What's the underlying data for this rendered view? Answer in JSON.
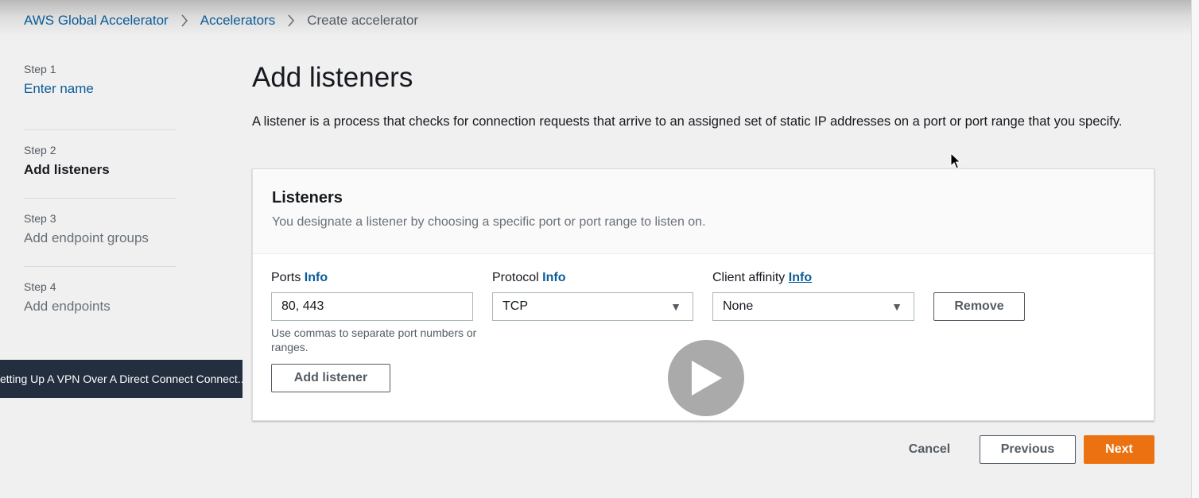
{
  "breadcrumb": {
    "items": [
      "AWS Global Accelerator",
      "Accelerators"
    ],
    "current": "Create accelerator"
  },
  "steps": [
    {
      "num": "Step 1",
      "label": "Enter name",
      "state": "link"
    },
    {
      "num": "Step 2",
      "label": "Add listeners",
      "state": "active"
    },
    {
      "num": "Step 3",
      "label": "Add endpoint groups",
      "state": "disabled"
    },
    {
      "num": "Step 4",
      "label": "Add endpoints",
      "state": "disabled"
    }
  ],
  "page": {
    "title": "Add listeners",
    "description": "A listener is a process that checks for connection requests that arrive to an assigned set of static IP addresses on a port or port range that you specify."
  },
  "listeners": {
    "title": "Listeners",
    "subtitle": "You designate a listener by choosing a specific port or port range to listen on.",
    "ports_label": "Ports",
    "protocol_label": "Protocol",
    "affinity_label": "Client affinity",
    "info_label": "Info",
    "ports_value": "80, 443",
    "ports_hint": "Use commas to separate port numbers or ranges.",
    "protocol_value": "TCP",
    "affinity_value": "None",
    "remove_label": "Remove",
    "add_label": "Add listener"
  },
  "footer": {
    "cancel": "Cancel",
    "previous": "Previous",
    "next": "Next"
  },
  "video": {
    "tooltip": "etting Up A VPN Over A Direct Connect Connect..."
  },
  "colors": {
    "link": "#0a5c98",
    "primary": "#ec7211",
    "tooltip_bg": "#232f3e"
  }
}
